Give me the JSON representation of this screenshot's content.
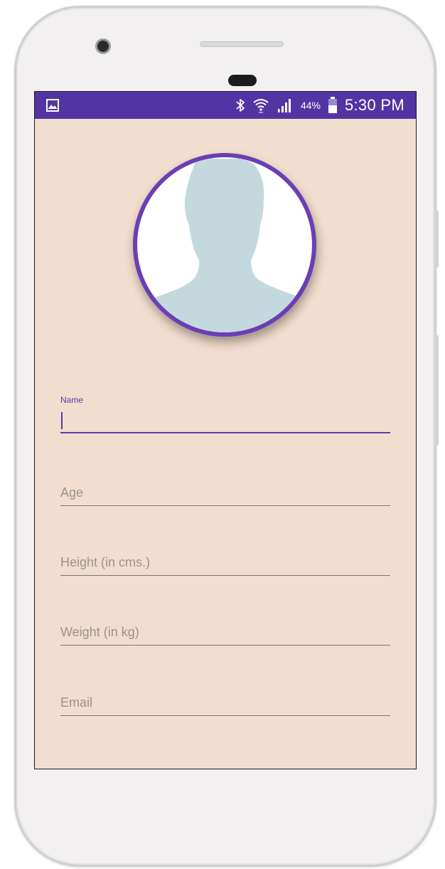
{
  "status_bar": {
    "battery_percent": "44%",
    "time": "5:30 PM",
    "icons": [
      "image-notification-icon",
      "bluetooth-icon",
      "wifi-icon",
      "signal-icon",
      "battery-icon"
    ]
  },
  "profile": {
    "avatar_icon": "person-silhouette-icon"
  },
  "form": {
    "name": {
      "label": "Name",
      "value": ""
    },
    "age": {
      "placeholder": "Age",
      "value": ""
    },
    "height": {
      "placeholder": "Height (in cms.)",
      "value": ""
    },
    "weight": {
      "placeholder": "Weight (in kg)",
      "value": ""
    },
    "email": {
      "placeholder": "Email",
      "value": ""
    }
  },
  "colors": {
    "primary": "#5235a3",
    "accent": "#6a3fb5",
    "background": "#f2dece"
  }
}
